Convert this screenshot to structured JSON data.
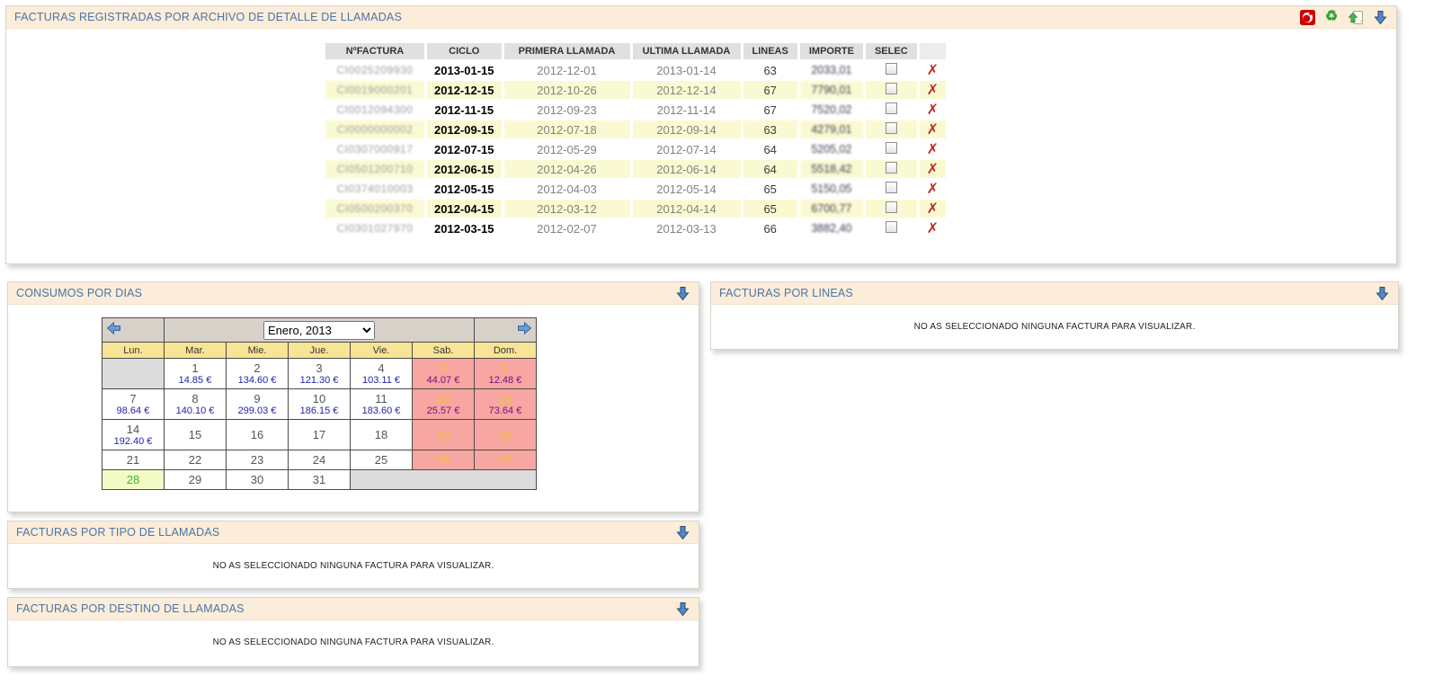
{
  "colors": {
    "panel_header_bg": "#FBEDD9",
    "panel_title": "#4A74A8",
    "table_header_bg": "#E0E0E0",
    "row_alt_bg": "#FAFAD2",
    "calendar_nav_bg": "#D6D2CA",
    "calendar_dow_bg": "#F8E495",
    "weekend_bg": "#F7A6A1",
    "weekend_day_color": "#EFC245",
    "weekend_amount_color": "#7B0E82",
    "today_bg": "#F4FAC3",
    "today_day_color": "#3CB43C",
    "amount_color": "#2222AA",
    "delete_x_color": "#C22B22",
    "logo_red": "#CE0000"
  },
  "invoices": {
    "title": "FACTURAS REGISTRADAS POR ARCHIVO DE DETALLE DE LLAMADAS",
    "icons": [
      "vodafone-logo",
      "refresh",
      "export-document",
      "collapse-arrow"
    ],
    "table": {
      "headers": [
        "NºFACTURA",
        "CICLO",
        "PRIMERA LLAMADA",
        "ULTIMA LLAMADA",
        "LINEAS",
        "IMPORTE",
        "SELEC"
      ],
      "redacted_columns": [
        "factura",
        "importe"
      ],
      "rows": [
        {
          "factura": "CI0025209930",
          "ciclo": "2013-01-15",
          "primera": "2012-12-01",
          "ultima": "2013-01-14",
          "lineas": "63",
          "importe": "2033,01"
        },
        {
          "factura": "CI0019000201",
          "ciclo": "2012-12-15",
          "primera": "2012-10-26",
          "ultima": "2012-12-14",
          "lineas": "67",
          "importe": "7790,01"
        },
        {
          "factura": "CI0012094300",
          "ciclo": "2012-11-15",
          "primera": "2012-09-23",
          "ultima": "2012-11-14",
          "lineas": "67",
          "importe": "7520,02"
        },
        {
          "factura": "CI0000000002",
          "ciclo": "2012-09-15",
          "primera": "2012-07-18",
          "ultima": "2012-09-14",
          "lineas": "63",
          "importe": "4279,01"
        },
        {
          "factura": "CI0307000917",
          "ciclo": "2012-07-15",
          "primera": "2012-05-29",
          "ultima": "2012-07-14",
          "lineas": "64",
          "importe": "5205,02"
        },
        {
          "factura": "CI0501200710",
          "ciclo": "2012-06-15",
          "primera": "2012-04-26",
          "ultima": "2012-06-14",
          "lineas": "64",
          "importe": "5518,42"
        },
        {
          "factura": "CI0374010003",
          "ciclo": "2012-05-15",
          "primera": "2012-04-03",
          "ultima": "2012-05-14",
          "lineas": "65",
          "importe": "5150,05"
        },
        {
          "factura": "CI0500200370",
          "ciclo": "2012-04-15",
          "primera": "2012-03-12",
          "ultima": "2012-04-14",
          "lineas": "65",
          "importe": "6700,77"
        },
        {
          "factura": "CI0301027970",
          "ciclo": "2012-03-15",
          "primera": "2012-02-07",
          "ultima": "2012-03-13",
          "lineas": "66",
          "importe": "3882,40"
        }
      ]
    }
  },
  "consumos": {
    "title": "CONSUMOS POR DIAS",
    "calendar": {
      "month_label": "Enero, 2013",
      "day_headers": [
        "Lun.",
        "Mar.",
        "Mie.",
        "Jue.",
        "Vie.",
        "Sab.",
        "Dom."
      ],
      "weeks": [
        [
          {
            "type": "empty"
          },
          {
            "day": "1",
            "amount": "14.85 €",
            "type": "weekday"
          },
          {
            "day": "2",
            "amount": "134.60 €",
            "type": "weekday"
          },
          {
            "day": "3",
            "amount": "121.30 €",
            "type": "weekday"
          },
          {
            "day": "4",
            "amount": "103.11 €",
            "type": "weekday"
          },
          {
            "day": "5",
            "amount": "44.07 €",
            "type": "weekend"
          },
          {
            "day": "6",
            "amount": "12.48 €",
            "type": "weekend"
          }
        ],
        [
          {
            "day": "7",
            "amount": "98.64 €",
            "type": "weekday"
          },
          {
            "day": "8",
            "amount": "140.10 €",
            "type": "weekday"
          },
          {
            "day": "9",
            "amount": "299.03 €",
            "type": "weekday"
          },
          {
            "day": "10",
            "amount": "186.15 €",
            "type": "weekday"
          },
          {
            "day": "11",
            "amount": "183.60 €",
            "type": "weekday"
          },
          {
            "day": "12",
            "amount": "25.57 €",
            "type": "weekend"
          },
          {
            "day": "13",
            "amount": "73.64 €",
            "type": "weekend"
          }
        ],
        [
          {
            "day": "14",
            "amount": "192.40 €",
            "type": "weekday"
          },
          {
            "day": "15",
            "type": "weekday"
          },
          {
            "day": "16",
            "type": "weekday"
          },
          {
            "day": "17",
            "type": "weekday"
          },
          {
            "day": "18",
            "type": "weekday"
          },
          {
            "day": "19",
            "type": "weekend"
          },
          {
            "day": "20",
            "type": "weekend"
          }
        ],
        [
          {
            "day": "21",
            "type": "weekday"
          },
          {
            "day": "22",
            "type": "weekday"
          },
          {
            "day": "23",
            "type": "weekday"
          },
          {
            "day": "24",
            "type": "weekday"
          },
          {
            "day": "25",
            "type": "weekday"
          },
          {
            "day": "26",
            "type": "weekend"
          },
          {
            "day": "27",
            "type": "weekend"
          }
        ],
        [
          {
            "day": "28",
            "type": "today"
          },
          {
            "day": "29",
            "type": "weekday"
          },
          {
            "day": "30",
            "type": "weekday"
          },
          {
            "day": "31",
            "type": "weekday"
          },
          {
            "type": "empty",
            "colspan": 3
          }
        ]
      ]
    }
  },
  "lineas": {
    "title": "FACTURAS POR LINEAS",
    "message": "NO AS SELECCIONADO NINGUNA FACTURA PARA VISUALIZAR."
  },
  "tipo": {
    "title": "FACTURAS POR TIPO DE LLAMADAS",
    "message": "NO AS SELECCIONADO NINGUNA FACTURA PARA VISUALIZAR."
  },
  "destino": {
    "title": "FACTURAS POR DESTINO DE LLAMADAS",
    "message": "NO AS SELECCIONADO NINGUNA FACTURA PARA VISUALIZAR."
  }
}
